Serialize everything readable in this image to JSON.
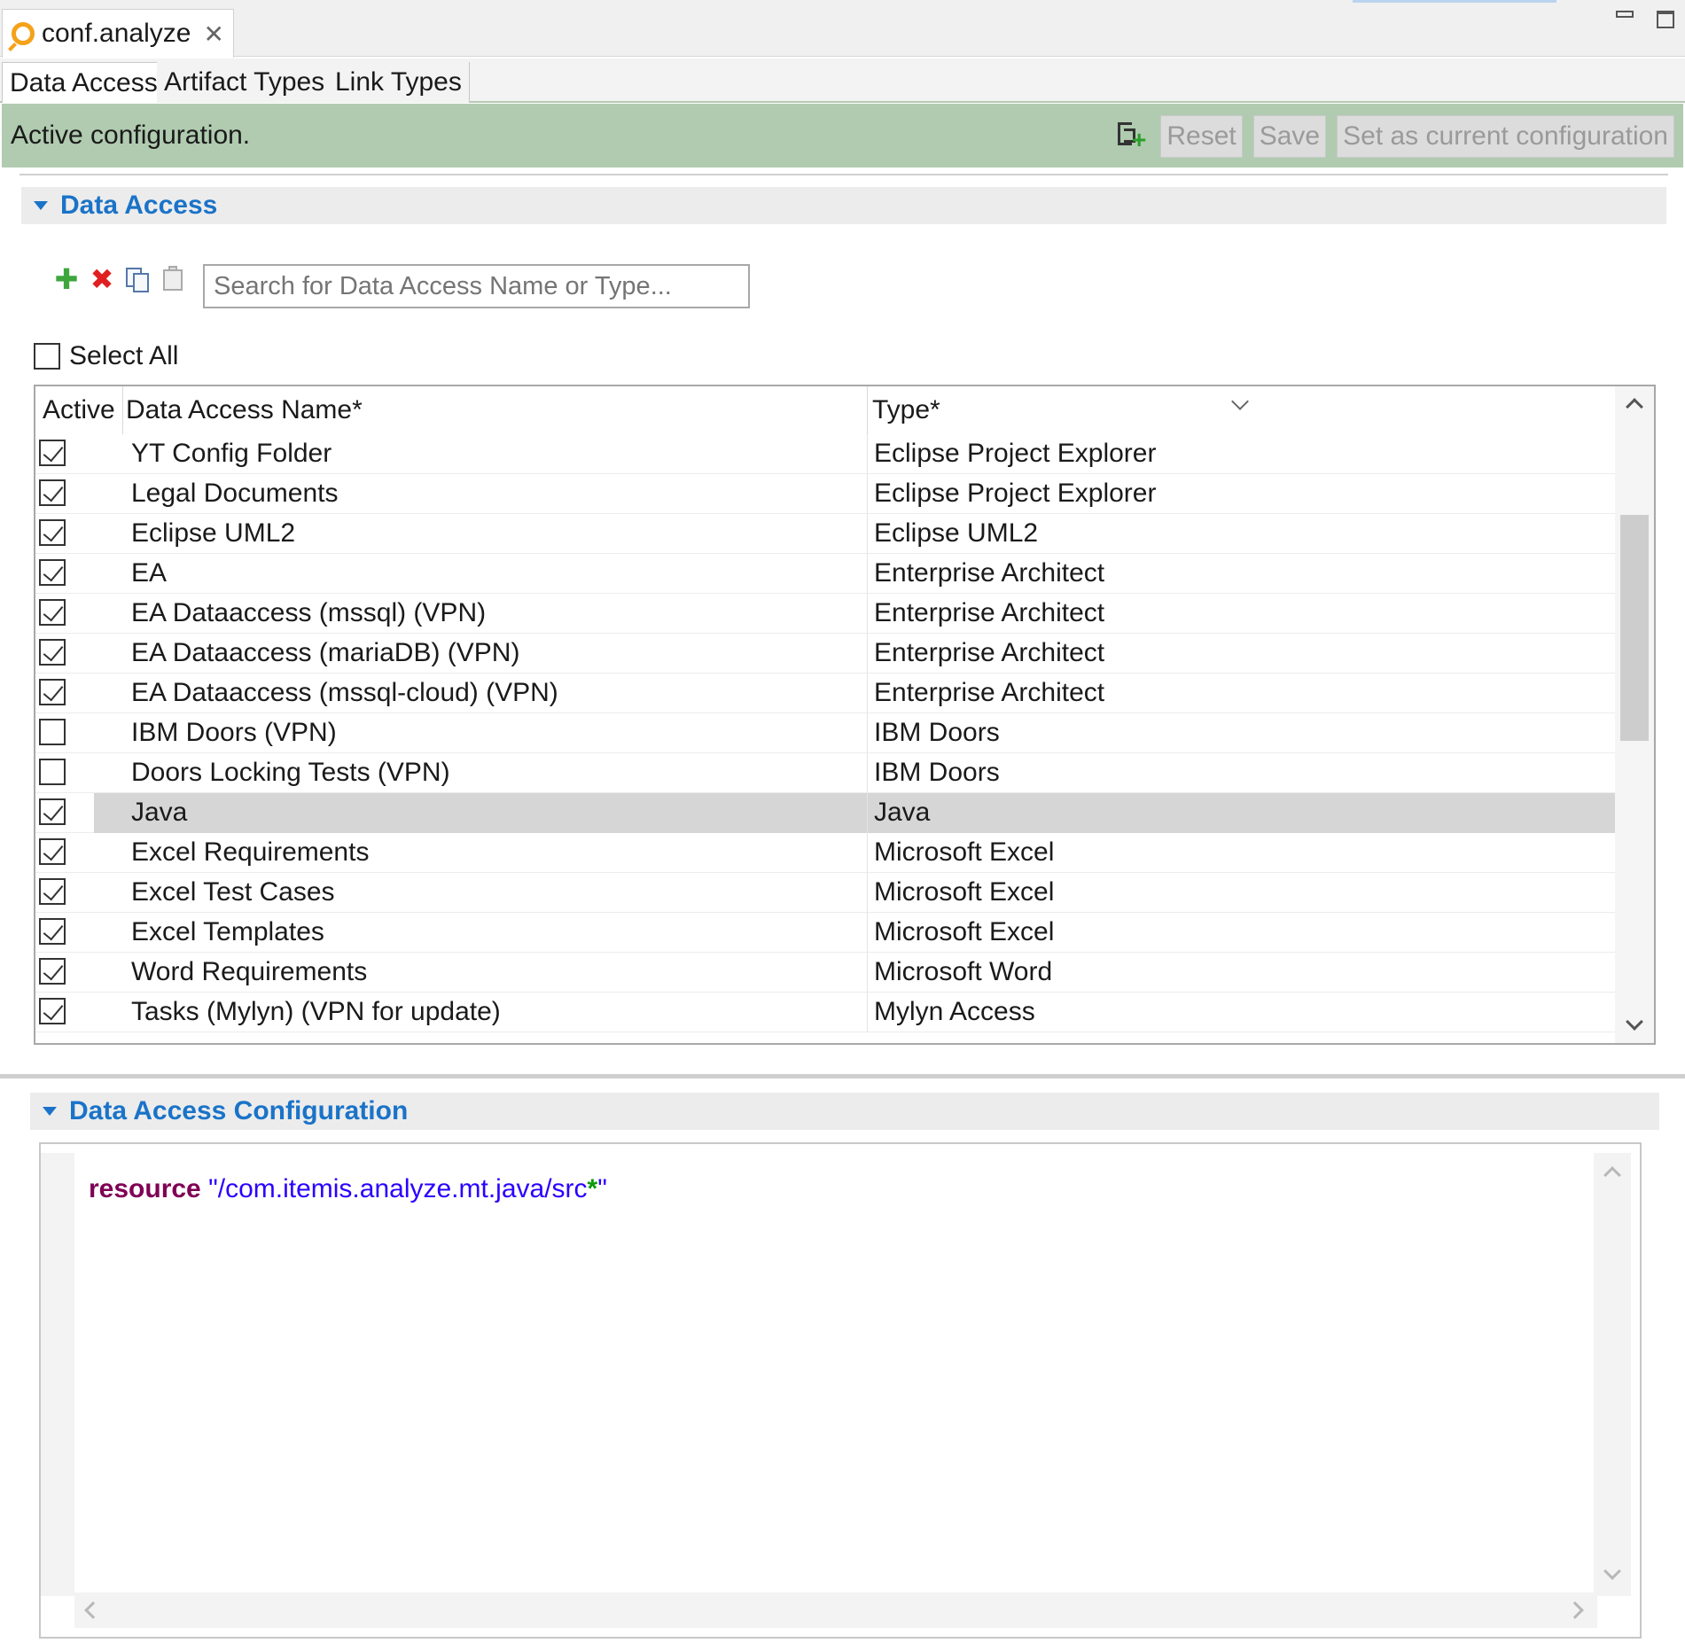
{
  "editor_tab": {
    "title": "conf.analyze",
    "icon": "analyze-ring-icon",
    "close_icon": "close-icon"
  },
  "page_tabs": [
    {
      "label": "Data Access",
      "active": true
    },
    {
      "label": "Artifact Types",
      "active": false
    },
    {
      "label": "Link Types",
      "active": false
    }
  ],
  "status": {
    "message": "Active configuration.",
    "color": "#b0cbb0",
    "export_icon": "export-config-icon",
    "buttons": {
      "reset": "Reset",
      "save": "Save",
      "set_current": "Set as current configuration"
    }
  },
  "data_access_section": {
    "title": "Data Access",
    "toolbar": {
      "add": "add-icon",
      "delete": "delete-icon",
      "copy": "copy-icon",
      "paste": "paste-icon"
    },
    "search_placeholder": "Search for Data Access Name or Type...",
    "select_all": "Select All",
    "columns": {
      "active": "Active",
      "name": "Data Access Name*",
      "type": "Type*"
    },
    "rows": [
      {
        "active": true,
        "name": "YT Config Folder",
        "type": "Eclipse Project Explorer"
      },
      {
        "active": true,
        "name": "Legal Documents",
        "type": "Eclipse Project Explorer"
      },
      {
        "active": true,
        "name": "Eclipse UML2",
        "type": "Eclipse UML2"
      },
      {
        "active": true,
        "name": "EA",
        "type": "Enterprise Architect"
      },
      {
        "active": true,
        "name": "EA Dataaccess (mssql) (VPN)",
        "type": "Enterprise Architect"
      },
      {
        "active": true,
        "name": "EA Dataaccess (mariaDB) (VPN)",
        "type": "Enterprise Architect"
      },
      {
        "active": true,
        "name": "EA Dataaccess (mssql-cloud) (VPN)",
        "type": "Enterprise Architect"
      },
      {
        "active": false,
        "name": "IBM Doors (VPN)",
        "type": "IBM Doors"
      },
      {
        "active": false,
        "name": "Doors Locking Tests (VPN)",
        "type": "IBM Doors"
      },
      {
        "active": true,
        "name": "Java",
        "type": "Java",
        "selected": true
      },
      {
        "active": true,
        "name": "Excel Requirements",
        "type": "Microsoft Excel"
      },
      {
        "active": true,
        "name": "Excel Test Cases",
        "type": "Microsoft Excel"
      },
      {
        "active": true,
        "name": "Excel Templates",
        "type": "Microsoft Excel"
      },
      {
        "active": true,
        "name": "Word Requirements",
        "type": "Microsoft Word"
      },
      {
        "active": true,
        "name": "Tasks (Mylyn) (VPN for update)",
        "type": "Mylyn Access"
      }
    ]
  },
  "config_section": {
    "title": "Data Access Configuration",
    "code": {
      "keyword": "resource",
      "string_start": "\"/com.itemis.analyze.mt.java/src",
      "wildcard": "*",
      "string_end": "\""
    }
  },
  "colors": {
    "accent": "#1a73c8",
    "selected_row": "#d6d6d6",
    "keyword": "#7f0055",
    "string": "#2a00ff"
  }
}
